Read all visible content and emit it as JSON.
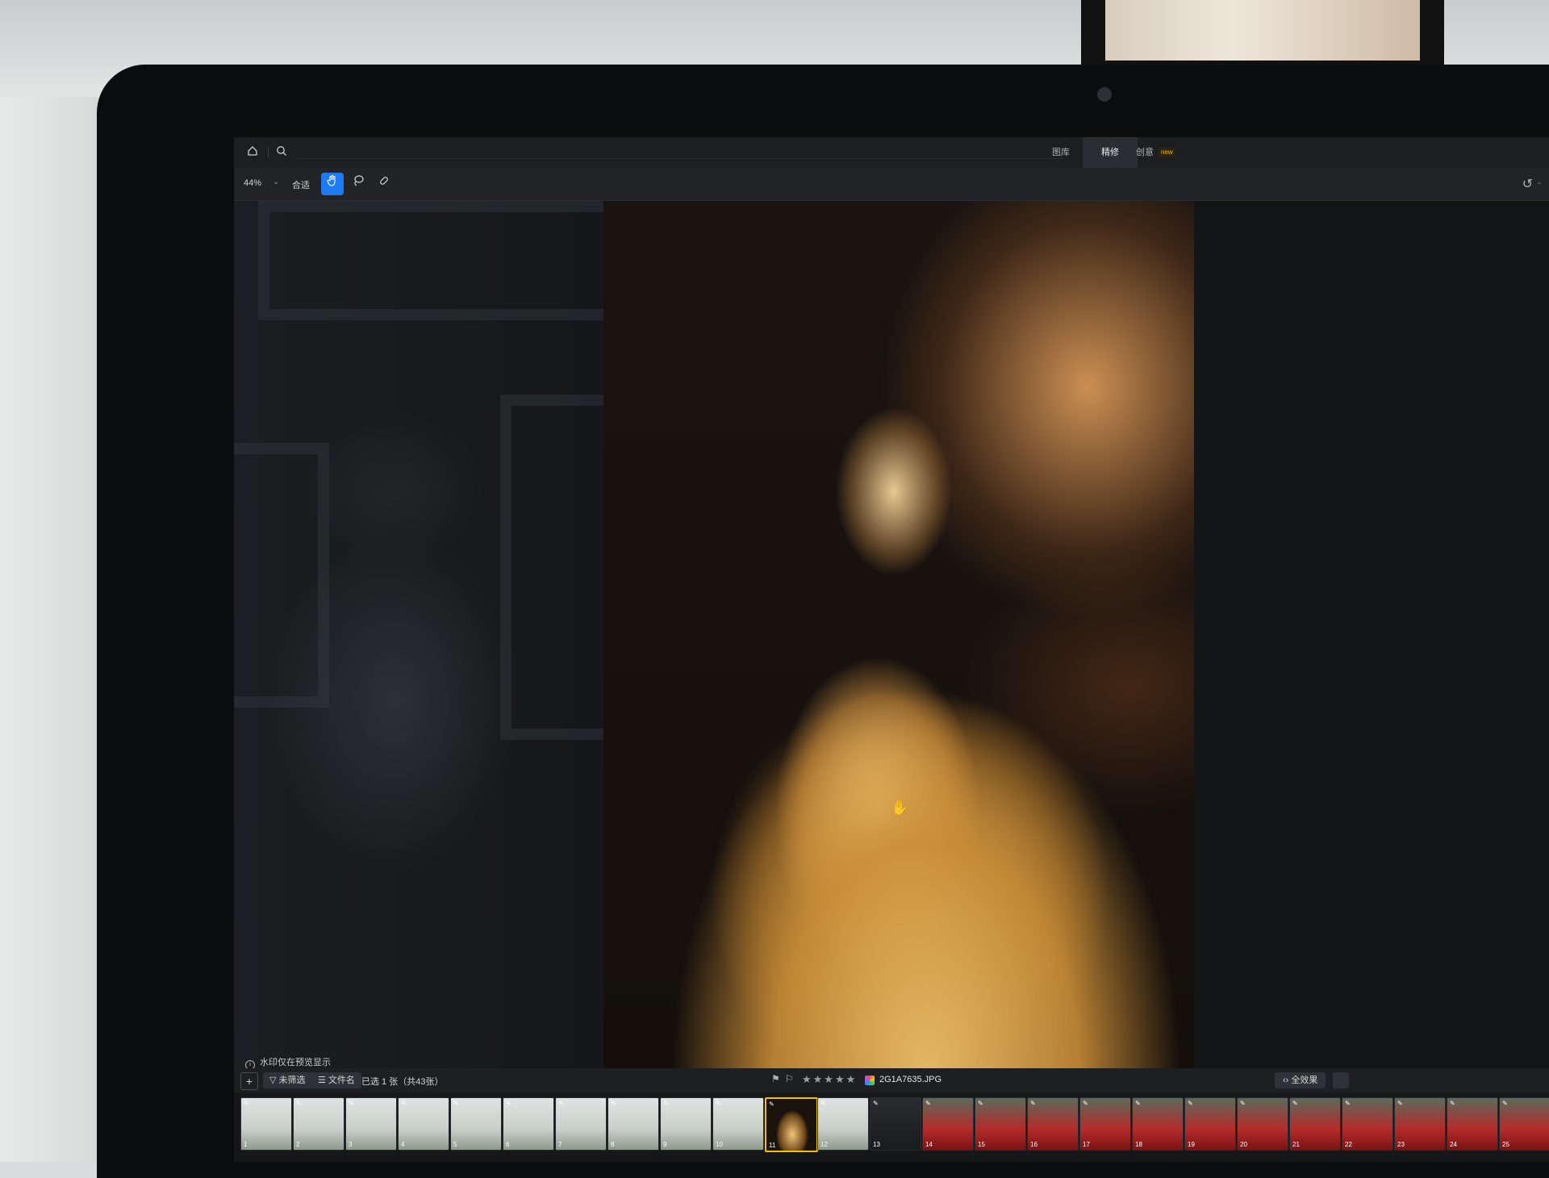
{
  "topbar": {
    "home_icon": "home-icon",
    "search_icon": "search-icon",
    "tabs": [
      {
        "label": "图库"
      },
      {
        "label": "精修"
      },
      {
        "label": "创意",
        "badge": "new"
      }
    ],
    "active_tab": "精修"
  },
  "toolbar": {
    "zoom": "44%",
    "fit": "合适",
    "tools": [
      {
        "name": "hand-tool-icon",
        "active": true
      },
      {
        "name": "lasso-tool-icon",
        "active": false
      },
      {
        "name": "healing-tool-icon",
        "active": false
      }
    ],
    "undo_icon": "undo-icon"
  },
  "canvas": {
    "watermark_note": "水印仅在预览显示"
  },
  "bottombar": {
    "add": "+",
    "filter": "未筛选",
    "sort": "文件名",
    "selection": "已选 1 张（共43张）",
    "filename": "2G1A7635.JPG",
    "full_view": "全效果",
    "accent": "#1f7bf2",
    "selected_border": "#f2c200"
  },
  "filmstrip": {
    "thumbnails": [
      {
        "num": "1",
        "tone": "light"
      },
      {
        "num": "2",
        "tone": "light"
      },
      {
        "num": "3",
        "tone": "light"
      },
      {
        "num": "4",
        "tone": "light"
      },
      {
        "num": "5",
        "tone": "light"
      },
      {
        "num": "6",
        "tone": "light"
      },
      {
        "num": "7",
        "tone": "light"
      },
      {
        "num": "8",
        "tone": "light"
      },
      {
        "num": "9",
        "tone": "light"
      },
      {
        "num": "10",
        "tone": "light"
      },
      {
        "num": "11",
        "tone": "gold",
        "selected": true
      },
      {
        "num": "12",
        "tone": "light"
      },
      {
        "num": "13",
        "tone": "dark"
      },
      {
        "num": "14",
        "tone": "red"
      },
      {
        "num": "15",
        "tone": "red"
      },
      {
        "num": "16",
        "tone": "red"
      },
      {
        "num": "17",
        "tone": "red"
      },
      {
        "num": "18",
        "tone": "red"
      },
      {
        "num": "19",
        "tone": "red"
      },
      {
        "num": "20",
        "tone": "red"
      },
      {
        "num": "21",
        "tone": "red"
      },
      {
        "num": "22",
        "tone": "red"
      },
      {
        "num": "23",
        "tone": "red"
      },
      {
        "num": "24",
        "tone": "red"
      },
      {
        "num": "25",
        "tone": "red"
      }
    ]
  }
}
